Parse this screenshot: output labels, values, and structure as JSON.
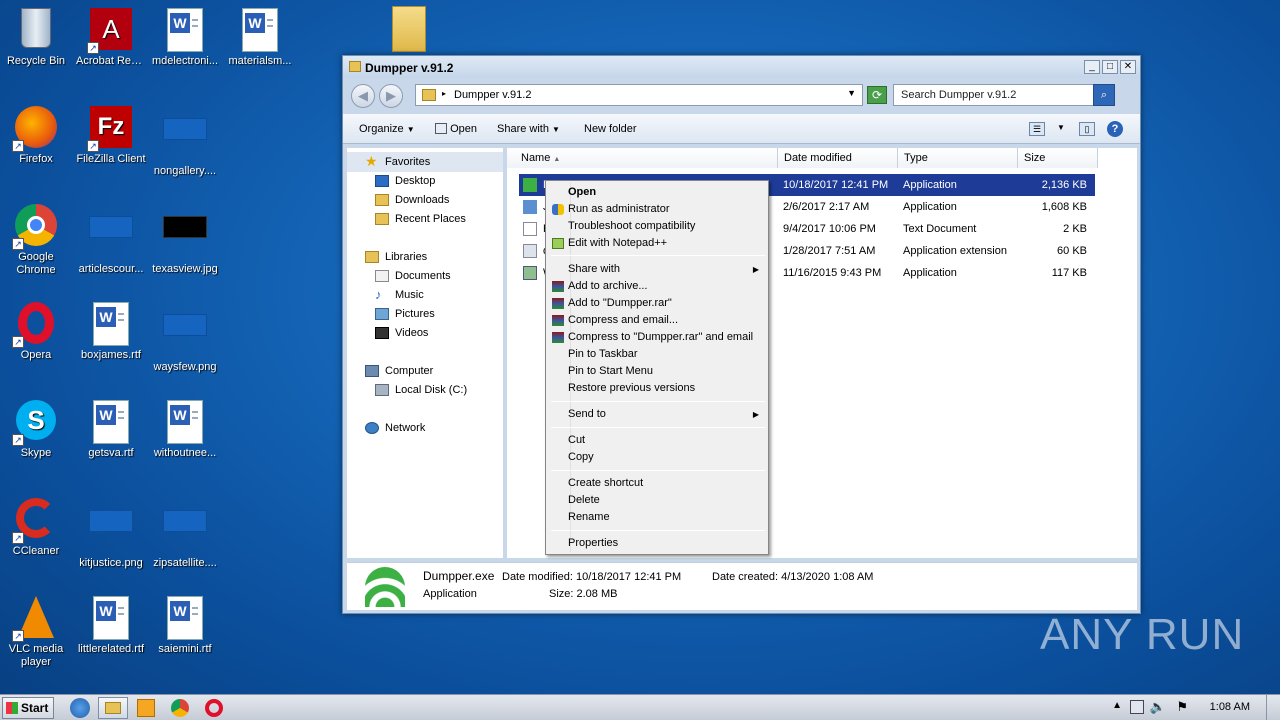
{
  "desktop": {
    "icons": [
      {
        "label": "Recycle Bin",
        "icon": "recycle-bin-icon"
      },
      {
        "label": "Acrobat Reader DC",
        "icon": "acrobat-icon"
      },
      {
        "label": "mdelectroni...",
        "icon": "word-doc-icon"
      },
      {
        "label": "materialsm...",
        "icon": "word-doc-icon"
      },
      {
        "label": "Firefox",
        "icon": "firefox-icon"
      },
      {
        "label": "FileZilla Client",
        "icon": "filezilla-icon"
      },
      {
        "label": "nongallery....",
        "icon": "image-file-icon"
      },
      {
        "label": "Google Chrome",
        "icon": "chrome-icon"
      },
      {
        "label": "articlescour...",
        "icon": "image-file-icon"
      },
      {
        "label": "texasview.jpg",
        "icon": "image-file-icon"
      },
      {
        "label": "Opera",
        "icon": "opera-icon"
      },
      {
        "label": "boxjames.rtf",
        "icon": "word-doc-icon"
      },
      {
        "label": "waysfew.png",
        "icon": "image-file-icon"
      },
      {
        "label": "Skype",
        "icon": "skype-icon"
      },
      {
        "label": "getsva.rtf",
        "icon": "word-doc-icon"
      },
      {
        "label": "withoutnee...",
        "icon": "word-doc-icon"
      },
      {
        "label": "CCleaner",
        "icon": "ccleaner-icon"
      },
      {
        "label": "kitjustice.png",
        "icon": "image-file-icon"
      },
      {
        "label": "zipsatellite....",
        "icon": "image-file-icon"
      },
      {
        "label": "VLC media player",
        "icon": "vlc-icon"
      },
      {
        "label": "littlerelated.rtf",
        "icon": "word-doc-icon"
      },
      {
        "label": "saiemini.rtf",
        "icon": "word-doc-icon"
      }
    ]
  },
  "window": {
    "title": "Dumpper v.91.2",
    "address": "Dumpper v.91.2",
    "search_placeholder": "Search Dumpper v.91.2",
    "toolbar": {
      "organize": "Organize",
      "open": "Open",
      "share_with": "Share with",
      "new_folder": "New folder"
    },
    "nav": {
      "favorites": "Favorites",
      "desktop": "Desktop",
      "downloads": "Downloads",
      "recent_places": "Recent Places",
      "libraries": "Libraries",
      "documents": "Documents",
      "music": "Music",
      "pictures": "Pictures",
      "videos": "Videos",
      "computer": "Computer",
      "local_disk": "Local Disk (C:)",
      "network": "Network"
    },
    "columns": {
      "name": "Name",
      "date_modified": "Date modified",
      "type": "Type",
      "size": "Size"
    },
    "files": [
      {
        "name": "Dumpper.exe",
        "date": "10/18/2017 12:41 PM",
        "type": "Application",
        "size": "2,136 KB"
      },
      {
        "name": "J",
        "date": "2/6/2017 2:17 AM",
        "type": "Application",
        "size": "1,608 KB"
      },
      {
        "name": "R",
        "date": "9/4/2017 10:06 PM",
        "type": "Text Document",
        "size": "2 KB"
      },
      {
        "name": "d",
        "date": "1/28/2017 7:51 AM",
        "type": "Application extension",
        "size": "60 KB"
      },
      {
        "name": "W",
        "date": "11/16/2015 9:43 PM",
        "type": "Application",
        "size": "117 KB"
      }
    ],
    "details": {
      "filename": "Dumpper.exe",
      "date_modified": "Date modified: 10/18/2017 12:41 PM",
      "date_created": "Date created: 4/13/2020 1:08 AM",
      "type": "Application",
      "size": "Size: 2.08 MB"
    }
  },
  "context_menu": {
    "open": "Open",
    "run_as_admin": "Run as administrator",
    "troubleshoot": "Troubleshoot compatibility",
    "edit_notepad": "Edit with Notepad++",
    "share_with": "Share with",
    "add_archive": "Add to archive...",
    "add_rar": "Add to \"Dumpper.rar\"",
    "compress_email": "Compress and email...",
    "compress_rar_email": "Compress to \"Dumpper.rar\" and email",
    "pin_taskbar": "Pin to Taskbar",
    "pin_start": "Pin to Start Menu",
    "restore": "Restore previous versions",
    "send_to": "Send to",
    "cut": "Cut",
    "copy": "Copy",
    "create_shortcut": "Create shortcut",
    "delete": "Delete",
    "rename": "Rename",
    "properties": "Properties"
  },
  "taskbar": {
    "start": "Start",
    "clock": "1:08 AM"
  },
  "watermark": "ANY RUN"
}
